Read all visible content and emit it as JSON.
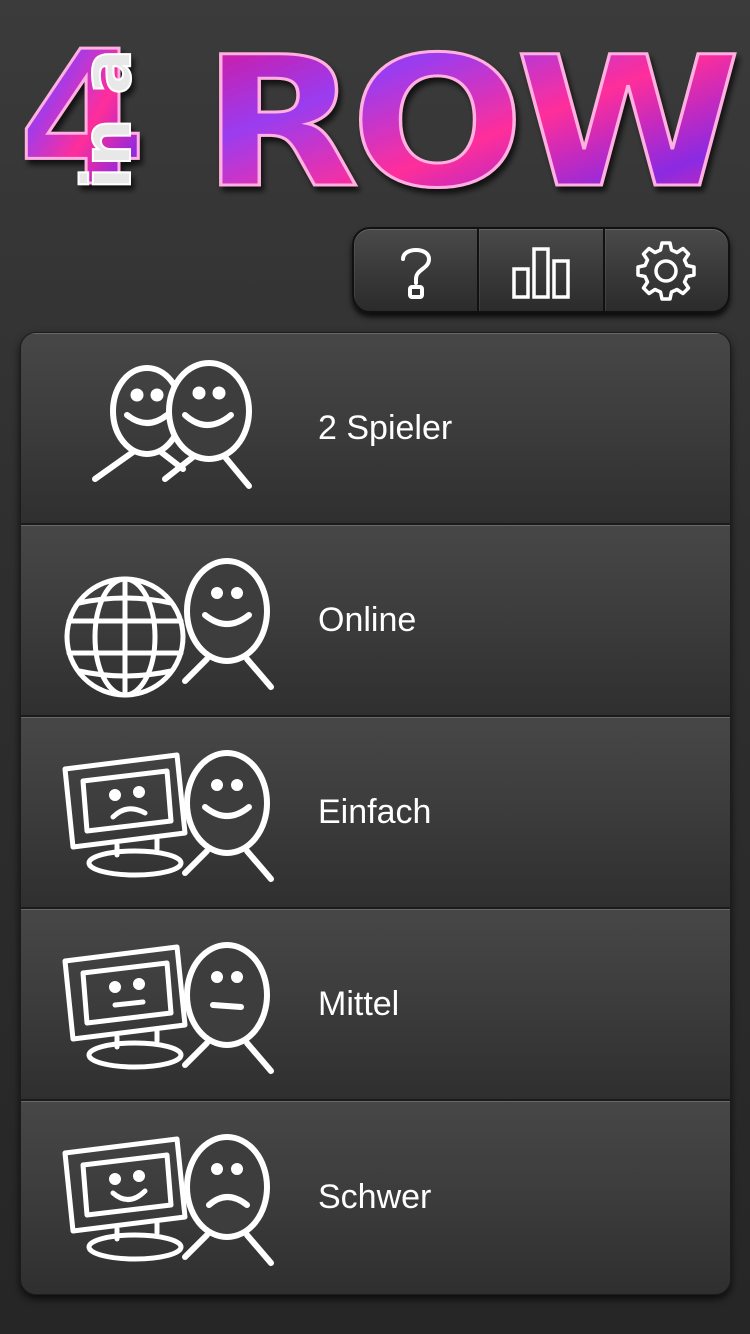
{
  "app": {
    "logo_text_big": "4",
    "logo_text_small": "in a",
    "logo_text_row": "ROW",
    "logo_colors": [
      "#e0108a",
      "#8a2be2",
      "#ff2d9a"
    ]
  },
  "toolbar": {
    "buttons": [
      {
        "icon": "help-icon",
        "glyph": "?"
      },
      {
        "icon": "stats-icon"
      },
      {
        "icon": "gear-icon"
      }
    ]
  },
  "menu": {
    "items": [
      {
        "label": "2 Spieler",
        "icon": "two-players-icon"
      },
      {
        "label": "Online",
        "icon": "globe-player-icon"
      },
      {
        "label": "Einfach",
        "icon": "computer-easy-icon"
      },
      {
        "label": "Mittel",
        "icon": "computer-medium-icon"
      },
      {
        "label": "Schwer",
        "icon": "computer-hard-icon"
      }
    ]
  }
}
